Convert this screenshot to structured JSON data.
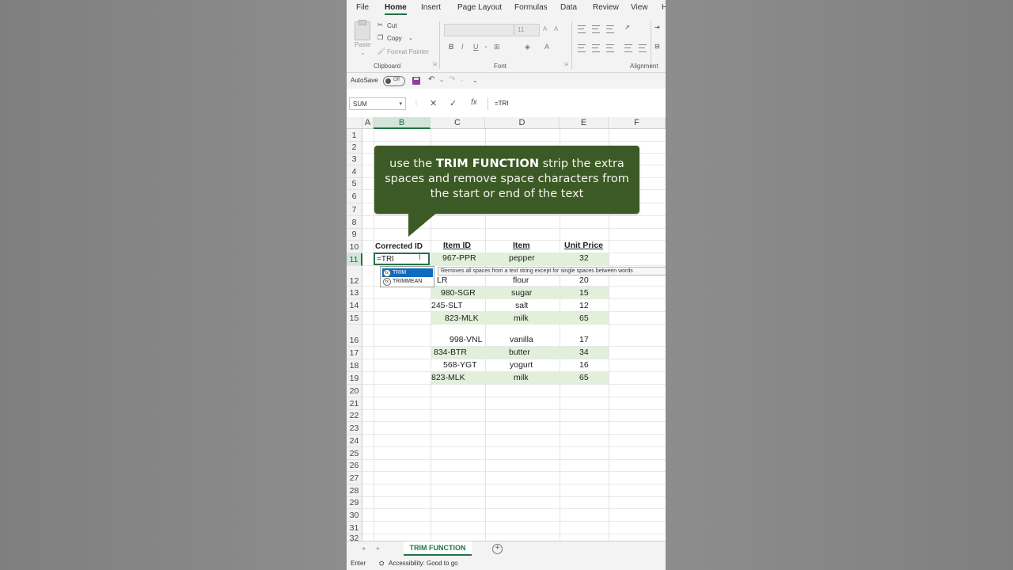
{
  "menu": {
    "tabs": [
      "File",
      "Home",
      "Insert",
      "Page Layout",
      "Formulas",
      "Data",
      "Review",
      "View",
      "H"
    ],
    "active": "Home"
  },
  "ribbon": {
    "clipboard": {
      "paste": "Paste",
      "cut": "Cut",
      "copy": "Copy",
      "format_painter": "Format Painter",
      "label": "Clipboard"
    },
    "font": {
      "size": "11",
      "bold": "B",
      "italic": "I",
      "underline": "U",
      "label": "Font"
    },
    "alignment": {
      "label": "Alignment"
    }
  },
  "qat": {
    "autosave_label": "AutoSave",
    "autosave_state": "Off"
  },
  "formula_bar": {
    "name_box": "SUM",
    "formula": "=TRI"
  },
  "columns": [
    "A",
    "B",
    "C",
    "D",
    "E",
    "F"
  ],
  "rows": [
    "1",
    "2",
    "3",
    "4",
    "5",
    "6",
    "7",
    "8",
    "9",
    "10",
    "11",
    "12",
    "13",
    "14",
    "15",
    "16",
    "17",
    "18",
    "19",
    "20",
    "21",
    "22",
    "23",
    "24",
    "25",
    "26",
    "27",
    "28",
    "29",
    "30",
    "31",
    "32"
  ],
  "callout": {
    "pre": "use the ",
    "bold": "TRIM FUNCTION",
    "post": " strip the extra spaces  and remove space characters from the start or end of the text"
  },
  "table": {
    "headers": {
      "corrected": "Corrected ID",
      "item_id": "Item ID",
      "item": "Item",
      "unit_price": "Unit Price"
    },
    "rows": [
      {
        "id": "967-PPR",
        "item": "pepper",
        "price": "32"
      },
      {
        "id": "LR",
        "item": "flour",
        "price": "20"
      },
      {
        "id": "980-SGR",
        "item": "sugar",
        "price": "15"
      },
      {
        "id": "245-SLT",
        "item": "salt",
        "price": "12"
      },
      {
        "id": "823-MLK",
        "item": "milk",
        "price": "65"
      },
      {
        "id": "998-VNL",
        "item": "vanilla",
        "price": "17"
      },
      {
        "id": "834-BTR",
        "item": "butter",
        "price": "34"
      },
      {
        "id": "568-YGT",
        "item": "yogurt",
        "price": "16"
      },
      {
        "id": "823-MLK",
        "item": "milk",
        "price": "65"
      }
    ]
  },
  "active_cell": {
    "value": "=TRI"
  },
  "autocomplete": {
    "items": [
      "TRIM",
      "TRIMMEAN"
    ],
    "tooltip": "Removes all spaces from a text string except for single spaces between words"
  },
  "sheet": {
    "tab": "TRIM FUNCTION"
  },
  "status": {
    "mode": "Enter",
    "accessibility": "Accessibility: Good to go"
  },
  "colors": {
    "excel_green": "#217346",
    "callout_bg": "#3c5a25",
    "row_shade": "#e2efda"
  }
}
